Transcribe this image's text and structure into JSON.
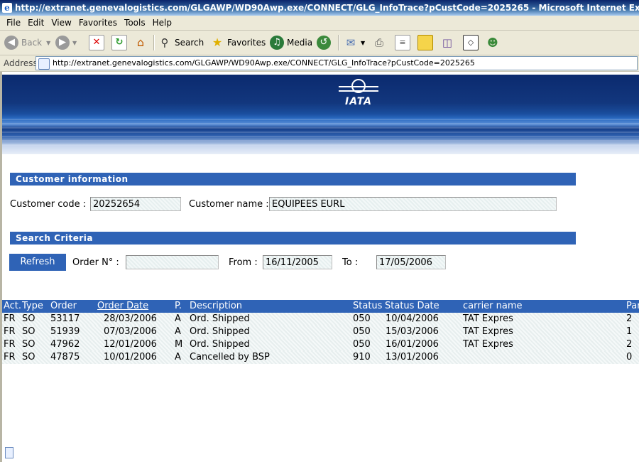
{
  "window": {
    "title": "http://extranet.genevalogistics.com/GLGAWP/WD90Awp.exe/CONNECT/GLG_InfoTrace?pCustCode=2025265 - Microsoft Internet Explorer"
  },
  "menu": {
    "items": [
      "File",
      "Edit",
      "View",
      "Favorites",
      "Tools",
      "Help"
    ]
  },
  "toolbar": {
    "back_label": "Back",
    "search_label": "Search",
    "favorites_label": "Favorites",
    "media_label": "Media"
  },
  "address": {
    "label": "Address",
    "url": "http://extranet.genevalogistics.com/GLGAWP/WD90Awp.exe/CONNECT/GLG_InfoTrace?pCustCode=2025265"
  },
  "banner": {
    "logo_text": "IATA"
  },
  "customer": {
    "section_title": "Customer information",
    "code_label": "Customer code :",
    "code_value": "20252654",
    "name_label": "Customer name :",
    "name_value": "EQUIPEES EURL"
  },
  "search": {
    "section_title": "Search Criteria",
    "refresh_label": "Refresh",
    "order_label": "Order N° :",
    "order_value": "",
    "from_label": "From :",
    "from_value": "16/11/2005",
    "to_label": "To :",
    "to_value": "17/05/2006"
  },
  "table": {
    "headers": [
      "Act.",
      "Type",
      "Order",
      "Order Date",
      "P.",
      "Description",
      "Status",
      "Status Date",
      "carrier name",
      "Par"
    ],
    "rows": [
      [
        "FR",
        "SO",
        "53117",
        "28/03/2006",
        "A",
        "Ord. Shipped",
        "050",
        "10/04/2006",
        "TAT Expres",
        "2"
      ],
      [
        "FR",
        "SO",
        "51939",
        "07/03/2006",
        "A",
        "Ord. Shipped",
        "050",
        "15/03/2006",
        "TAT Expres",
        "1"
      ],
      [
        "FR",
        "SO",
        "47962",
        "12/01/2006",
        "M",
        "Ord. Shipped",
        "050",
        "16/01/2006",
        "TAT Expres",
        "2"
      ],
      [
        "FR",
        "SO",
        "47875",
        "10/01/2006",
        "A",
        "Cancelled by BSP",
        "910",
        "13/01/2006",
        "",
        "0"
      ]
    ]
  }
}
